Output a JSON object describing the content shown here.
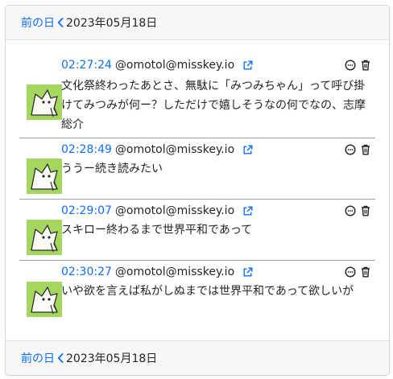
{
  "nav_top": {
    "prev_label": "前の日",
    "date": "2023年05月18日"
  },
  "nav_bottom": {
    "prev_label": "前の日",
    "date": "2023年05月18日"
  },
  "posts": [
    {
      "time": "02:27:24",
      "user": "@omotol@misskey.io",
      "text": "文化祭終わったあとさ、無駄に「みつみちゃん」って呼び掛けてみつみが何ー？しただけで嬉しそうなの何でなの、志摩総介"
    },
    {
      "time": "02:28:49",
      "user": "@omotol@misskey.io",
      "text": "ううー続き読みたい"
    },
    {
      "time": "02:29:07",
      "user": "@omotol@misskey.io",
      "text": "スキロー終わるまで世界平和であって"
    },
    {
      "time": "02:30:27",
      "user": "@omotol@misskey.io",
      "text": "いや欲を言えば私がしぬまでは世界平和であって欲しいが"
    }
  ],
  "colors": {
    "link": "#0d6efd",
    "avatar_bg": "#a5d75f"
  },
  "icons": {
    "external": "external-link-icon",
    "quote": "quote-icon",
    "delete": "trash-icon",
    "nav": "chevron-left-icon"
  }
}
